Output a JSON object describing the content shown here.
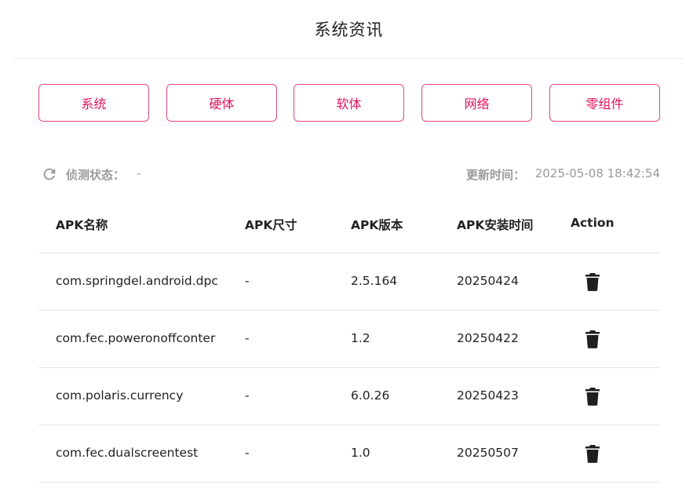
{
  "header": {
    "title": "系统资讯"
  },
  "tabs": [
    {
      "label": "系统"
    },
    {
      "label": "硬体"
    },
    {
      "label": "软体"
    },
    {
      "label": "网络"
    },
    {
      "label": "零组件"
    }
  ],
  "status": {
    "refresh_icon": "refresh-icon",
    "detect_label": "侦测状态：",
    "detect_value": "-",
    "update_label": "更新时间：",
    "update_value": "2025-05-08 18:42:54"
  },
  "table": {
    "columns": [
      "APK名称",
      "APK尺寸",
      "APK版本",
      "APK安装时间",
      "Action"
    ],
    "rows": [
      {
        "name": "com.springdel.android.dpc",
        "size": "-",
        "version": "2.5.164",
        "install_time": "20250424",
        "action_icon": "trash-icon"
      },
      {
        "name": "com.fec.poweronoffconter",
        "size": "-",
        "version": "1.2",
        "install_time": "20250422",
        "action_icon": "trash-icon"
      },
      {
        "name": "com.polaris.currency",
        "size": "-",
        "version": "6.0.26",
        "install_time": "20250423",
        "action_icon": "trash-icon"
      },
      {
        "name": "com.fec.dualscreentest",
        "size": "-",
        "version": "1.0",
        "install_time": "20250507",
        "action_icon": "trash-icon"
      }
    ]
  },
  "colors": {
    "accent": "#e0115f",
    "muted": "#9a9a9a",
    "divider": "#e6e6e6"
  }
}
